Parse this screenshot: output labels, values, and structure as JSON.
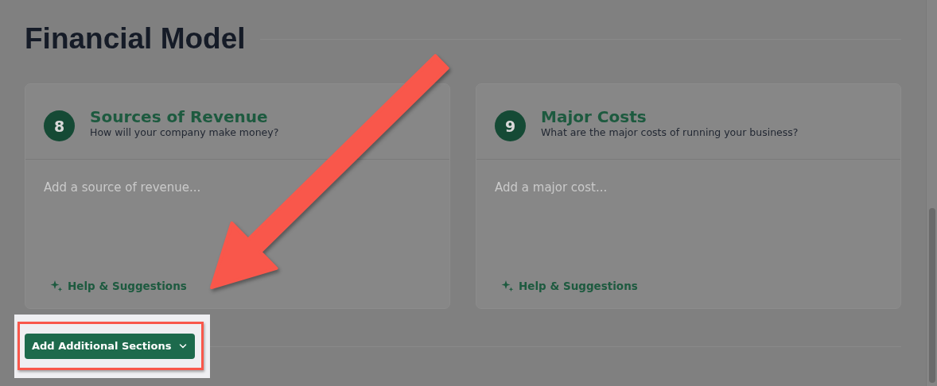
{
  "heading": "Financial Model",
  "sections": [
    {
      "number": "8",
      "title": "Sources of Revenue",
      "subtitle": "How will your company make money?",
      "placeholder": "Add a source of revenue...",
      "help_link": "Help & Suggestions"
    },
    {
      "number": "9",
      "title": "Major Costs",
      "subtitle": "What are the major costs of running your business?",
      "placeholder": "Add a major cost...",
      "help_link": "Help & Suggestions"
    }
  ],
  "add_button": {
    "label": "Add Additional Sections"
  }
}
